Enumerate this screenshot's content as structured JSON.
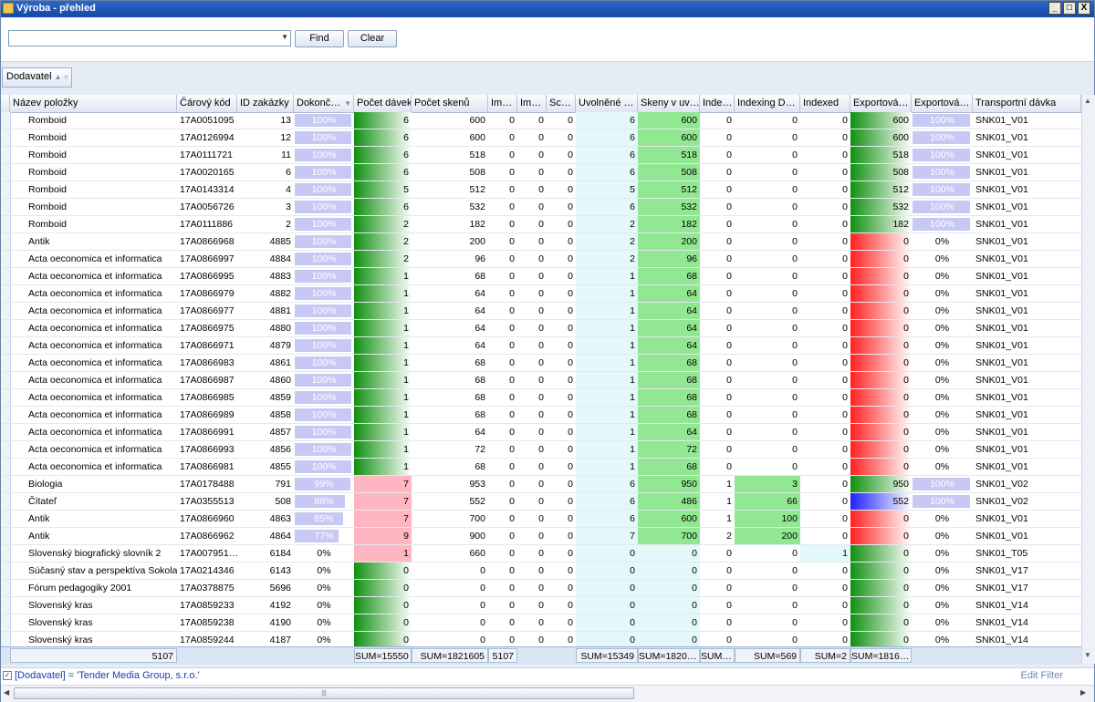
{
  "window": {
    "title": "Výroba - přehled",
    "btn_min": "_",
    "btn_max": "□",
    "btn_close": "X"
  },
  "toolbar": {
    "search_value": "",
    "find_label": "Find",
    "clear_label": "Clear"
  },
  "group_by": {
    "label": "Dodavatel"
  },
  "columns": [
    "Název položky",
    "Čárový kód",
    "ID zakázky",
    "Dokonč…",
    "Počet dávek",
    "Počet skenů",
    "Im…",
    "Im…",
    "Sc…",
    "Uvolněné …",
    "Skeny v uv…",
    "Inde…",
    "Indexing D…",
    "Indexed",
    "Exportová…",
    "Exportová…",
    "Transportní dávka"
  ],
  "rows": [
    {
      "n": "Romboid",
      "code": "17A0051095",
      "id": "13",
      "pct": 100,
      "pct_label": "100%",
      "davky": "6",
      "skeny": "600",
      "im1": "0",
      "im2": "0",
      "sc": "0",
      "uvol": "6",
      "skuv": "600",
      "ind": "0",
      "indd": "0",
      "indexed": "0",
      "exp": "600",
      "exp_state": "green",
      "exppct": 100,
      "exppct_label": "100%",
      "trans": "SNK01_V01",
      "pd_state": "green"
    },
    {
      "n": "Romboid",
      "code": "17A0126994",
      "id": "12",
      "pct": 100,
      "pct_label": "100%",
      "davky": "6",
      "skeny": "600",
      "im1": "0",
      "im2": "0",
      "sc": "0",
      "uvol": "6",
      "skuv": "600",
      "ind": "0",
      "indd": "0",
      "indexed": "0",
      "exp": "600",
      "exp_state": "green",
      "exppct": 100,
      "exppct_label": "100%",
      "trans": "SNK01_V01",
      "pd_state": "green"
    },
    {
      "n": "Romboid",
      "code": "17A0111721",
      "id": "11",
      "pct": 100,
      "pct_label": "100%",
      "davky": "6",
      "skeny": "518",
      "im1": "0",
      "im2": "0",
      "sc": "0",
      "uvol": "6",
      "skuv": "518",
      "ind": "0",
      "indd": "0",
      "indexed": "0",
      "exp": "518",
      "exp_state": "green",
      "exppct": 100,
      "exppct_label": "100%",
      "trans": "SNK01_V01",
      "pd_state": "green"
    },
    {
      "n": "Romboid",
      "code": "17A0020165",
      "id": "6",
      "pct": 100,
      "pct_label": "100%",
      "davky": "6",
      "skeny": "508",
      "im1": "0",
      "im2": "0",
      "sc": "0",
      "uvol": "6",
      "skuv": "508",
      "ind": "0",
      "indd": "0",
      "indexed": "0",
      "exp": "508",
      "exp_state": "green",
      "exppct": 100,
      "exppct_label": "100%",
      "trans": "SNK01_V01",
      "pd_state": "green"
    },
    {
      "n": "Romboid",
      "code": "17A0143314",
      "id": "4",
      "pct": 100,
      "pct_label": "100%",
      "davky": "5",
      "skeny": "512",
      "im1": "0",
      "im2": "0",
      "sc": "0",
      "uvol": "5",
      "skuv": "512",
      "ind": "0",
      "indd": "0",
      "indexed": "0",
      "exp": "512",
      "exp_state": "green",
      "exppct": 100,
      "exppct_label": "100%",
      "trans": "SNK01_V01",
      "pd_state": "green"
    },
    {
      "n": "Romboid",
      "code": "17A0056726",
      "id": "3",
      "pct": 100,
      "pct_label": "100%",
      "davky": "6",
      "skeny": "532",
      "im1": "0",
      "im2": "0",
      "sc": "0",
      "uvol": "6",
      "skuv": "532",
      "ind": "0",
      "indd": "0",
      "indexed": "0",
      "exp": "532",
      "exp_state": "green",
      "exppct": 100,
      "exppct_label": "100%",
      "trans": "SNK01_V01",
      "pd_state": "green"
    },
    {
      "n": "Romboid",
      "code": "17A0111886",
      "id": "2",
      "pct": 100,
      "pct_label": "100%",
      "davky": "2",
      "skeny": "182",
      "im1": "0",
      "im2": "0",
      "sc": "0",
      "uvol": "2",
      "skuv": "182",
      "ind": "0",
      "indd": "0",
      "indexed": "0",
      "exp": "182",
      "exp_state": "green",
      "exppct": 100,
      "exppct_label": "100%",
      "trans": "SNK01_V01",
      "pd_state": "green"
    },
    {
      "n": "Antik",
      "code": "17A0866968",
      "id": "4885",
      "pct": 100,
      "pct_label": "100%",
      "davky": "2",
      "skeny": "200",
      "im1": "0",
      "im2": "0",
      "sc": "0",
      "uvol": "2",
      "skuv": "200",
      "ind": "0",
      "indd": "0",
      "indexed": "0",
      "exp": "0",
      "exp_state": "red",
      "exppct": 0,
      "exppct_label": "0%",
      "trans": "SNK01_V01",
      "pd_state": "green"
    },
    {
      "n": "Acta oeconomica et informatica",
      "code": "17A0866997",
      "id": "4884",
      "pct": 100,
      "pct_label": "100%",
      "davky": "2",
      "skeny": "96",
      "im1": "0",
      "im2": "0",
      "sc": "0",
      "uvol": "2",
      "skuv": "96",
      "ind": "0",
      "indd": "0",
      "indexed": "0",
      "exp": "0",
      "exp_state": "red",
      "exppct": 0,
      "exppct_label": "0%",
      "trans": "SNK01_V01",
      "pd_state": "green"
    },
    {
      "n": "Acta oeconomica et informatica",
      "code": "17A0866995",
      "id": "4883",
      "pct": 100,
      "pct_label": "100%",
      "davky": "1",
      "skeny": "68",
      "im1": "0",
      "im2": "0",
      "sc": "0",
      "uvol": "1",
      "skuv": "68",
      "ind": "0",
      "indd": "0",
      "indexed": "0",
      "exp": "0",
      "exp_state": "red",
      "exppct": 0,
      "exppct_label": "0%",
      "trans": "SNK01_V01",
      "pd_state": "green"
    },
    {
      "n": "Acta oeconomica et informatica",
      "code": "17A0866979",
      "id": "4882",
      "pct": 100,
      "pct_label": "100%",
      "davky": "1",
      "skeny": "64",
      "im1": "0",
      "im2": "0",
      "sc": "0",
      "uvol": "1",
      "skuv": "64",
      "ind": "0",
      "indd": "0",
      "indexed": "0",
      "exp": "0",
      "exp_state": "red",
      "exppct": 0,
      "exppct_label": "0%",
      "trans": "SNK01_V01",
      "pd_state": "green"
    },
    {
      "n": "Acta oeconomica et informatica",
      "code": "17A0866977",
      "id": "4881",
      "pct": 100,
      "pct_label": "100%",
      "davky": "1",
      "skeny": "64",
      "im1": "0",
      "im2": "0",
      "sc": "0",
      "uvol": "1",
      "skuv": "64",
      "ind": "0",
      "indd": "0",
      "indexed": "0",
      "exp": "0",
      "exp_state": "red",
      "exppct": 0,
      "exppct_label": "0%",
      "trans": "SNK01_V01",
      "pd_state": "green"
    },
    {
      "n": "Acta oeconomica et informatica",
      "code": "17A0866975",
      "id": "4880",
      "pct": 100,
      "pct_label": "100%",
      "davky": "1",
      "skeny": "64",
      "im1": "0",
      "im2": "0",
      "sc": "0",
      "uvol": "1",
      "skuv": "64",
      "ind": "0",
      "indd": "0",
      "indexed": "0",
      "exp": "0",
      "exp_state": "red",
      "exppct": 0,
      "exppct_label": "0%",
      "trans": "SNK01_V01",
      "pd_state": "green"
    },
    {
      "n": "Acta oeconomica et informatica",
      "code": "17A0866971",
      "id": "4879",
      "pct": 100,
      "pct_label": "100%",
      "davky": "1",
      "skeny": "64",
      "im1": "0",
      "im2": "0",
      "sc": "0",
      "uvol": "1",
      "skuv": "64",
      "ind": "0",
      "indd": "0",
      "indexed": "0",
      "exp": "0",
      "exp_state": "red",
      "exppct": 0,
      "exppct_label": "0%",
      "trans": "SNK01_V01",
      "pd_state": "green"
    },
    {
      "n": "Acta oeconomica et informatica",
      "code": "17A0866983",
      "id": "4861",
      "pct": 100,
      "pct_label": "100%",
      "davky": "1",
      "skeny": "68",
      "im1": "0",
      "im2": "0",
      "sc": "0",
      "uvol": "1",
      "skuv": "68",
      "ind": "0",
      "indd": "0",
      "indexed": "0",
      "exp": "0",
      "exp_state": "red",
      "exppct": 0,
      "exppct_label": "0%",
      "trans": "SNK01_V01",
      "pd_state": "green"
    },
    {
      "n": "Acta oeconomica et informatica",
      "code": "17A0866987",
      "id": "4860",
      "pct": 100,
      "pct_label": "100%",
      "davky": "1",
      "skeny": "68",
      "im1": "0",
      "im2": "0",
      "sc": "0",
      "uvol": "1",
      "skuv": "68",
      "ind": "0",
      "indd": "0",
      "indexed": "0",
      "exp": "0",
      "exp_state": "red",
      "exppct": 0,
      "exppct_label": "0%",
      "trans": "SNK01_V01",
      "pd_state": "green"
    },
    {
      "n": "Acta oeconomica et informatica",
      "code": "17A0866985",
      "id": "4859",
      "pct": 100,
      "pct_label": "100%",
      "davky": "1",
      "skeny": "68",
      "im1": "0",
      "im2": "0",
      "sc": "0",
      "uvol": "1",
      "skuv": "68",
      "ind": "0",
      "indd": "0",
      "indexed": "0",
      "exp": "0",
      "exp_state": "red",
      "exppct": 0,
      "exppct_label": "0%",
      "trans": "SNK01_V01",
      "pd_state": "green"
    },
    {
      "n": "Acta oeconomica et informatica",
      "code": "17A0866989",
      "id": "4858",
      "pct": 100,
      "pct_label": "100%",
      "davky": "1",
      "skeny": "68",
      "im1": "0",
      "im2": "0",
      "sc": "0",
      "uvol": "1",
      "skuv": "68",
      "ind": "0",
      "indd": "0",
      "indexed": "0",
      "exp": "0",
      "exp_state": "red",
      "exppct": 0,
      "exppct_label": "0%",
      "trans": "SNK01_V01",
      "pd_state": "green"
    },
    {
      "n": "Acta oeconomica et informatica",
      "code": "17A0866991",
      "id": "4857",
      "pct": 100,
      "pct_label": "100%",
      "davky": "1",
      "skeny": "64",
      "im1": "0",
      "im2": "0",
      "sc": "0",
      "uvol": "1",
      "skuv": "64",
      "ind": "0",
      "indd": "0",
      "indexed": "0",
      "exp": "0",
      "exp_state": "red",
      "exppct": 0,
      "exppct_label": "0%",
      "trans": "SNK01_V01",
      "pd_state": "green"
    },
    {
      "n": "Acta oeconomica et informatica",
      "code": "17A0866993",
      "id": "4856",
      "pct": 100,
      "pct_label": "100%",
      "davky": "1",
      "skeny": "72",
      "im1": "0",
      "im2": "0",
      "sc": "0",
      "uvol": "1",
      "skuv": "72",
      "ind": "0",
      "indd": "0",
      "indexed": "0",
      "exp": "0",
      "exp_state": "red",
      "exppct": 0,
      "exppct_label": "0%",
      "trans": "SNK01_V01",
      "pd_state": "green"
    },
    {
      "n": "Acta oeconomica et informatica",
      "code": "17A0866981",
      "id": "4855",
      "pct": 100,
      "pct_label": "100%",
      "davky": "1",
      "skeny": "68",
      "im1": "0",
      "im2": "0",
      "sc": "0",
      "uvol": "1",
      "skuv": "68",
      "ind": "0",
      "indd": "0",
      "indexed": "0",
      "exp": "0",
      "exp_state": "red",
      "exppct": 0,
      "exppct_label": "0%",
      "trans": "SNK01_V01",
      "pd_state": "green"
    },
    {
      "n": "Biologia",
      "code": "17A0178488",
      "id": "791",
      "pct": 99,
      "pct_label": "99%",
      "davky": "7",
      "skeny": "953",
      "im1": "0",
      "im2": "0",
      "sc": "0",
      "uvol": "6",
      "skuv": "950",
      "ind": "1",
      "indd": "3",
      "indexed": "0",
      "exp": "950",
      "exp_state": "green",
      "exppct": 100,
      "exppct_label": "100%",
      "trans": "SNK01_V02",
      "pd_state": "pink"
    },
    {
      "n": "Čítateľ",
      "code": "17A0355513",
      "id": "508",
      "pct": 88,
      "pct_label": "88%",
      "davky": "7",
      "skeny": "552",
      "im1": "0",
      "im2": "0",
      "sc": "0",
      "uvol": "6",
      "skuv": "486",
      "ind": "1",
      "indd": "66",
      "indexed": "0",
      "exp": "552",
      "exp_state": "blue",
      "exppct": 100,
      "exppct_label": "100%",
      "trans": "SNK01_V02",
      "pd_state": "pink"
    },
    {
      "n": "Antik",
      "code": "17A0866960",
      "id": "4863",
      "pct": 85,
      "pct_label": "85%",
      "davky": "7",
      "skeny": "700",
      "im1": "0",
      "im2": "0",
      "sc": "0",
      "uvol": "6",
      "skuv": "600",
      "ind": "1",
      "indd": "100",
      "indexed": "0",
      "exp": "0",
      "exp_state": "red",
      "exppct": 0,
      "exppct_label": "0%",
      "trans": "SNK01_V01",
      "pd_state": "pink"
    },
    {
      "n": "Antik",
      "code": "17A0866962",
      "id": "4864",
      "pct": 77,
      "pct_label": "77%",
      "davky": "9",
      "skeny": "900",
      "im1": "0",
      "im2": "0",
      "sc": "0",
      "uvol": "7",
      "skuv": "700",
      "ind": "2",
      "indd": "200",
      "indexed": "0",
      "exp": "0",
      "exp_state": "red",
      "exppct": 0,
      "exppct_label": "0%",
      "trans": "SNK01_V01",
      "pd_state": "pink"
    },
    {
      "n": "Slovenský biografický slovník 2",
      "code": "17A007951…",
      "id": "6184",
      "pct": 0,
      "pct_label": "0%",
      "davky": "1",
      "skeny": "660",
      "im1": "0",
      "im2": "0",
      "sc": "0",
      "uvol": "0",
      "skuv": "0",
      "ind": "0",
      "indd": "0",
      "indexed": "1",
      "exp": "0",
      "exp_state": "green",
      "exppct": 0,
      "exppct_label": "0%",
      "trans": "SNK01_T05",
      "pd_state": "pink"
    },
    {
      "n": "Súčasný stav a perspektíva Sokola",
      "code": "17A0214346",
      "id": "6143",
      "pct": 0,
      "pct_label": "0%",
      "davky": "0",
      "skeny": "0",
      "im1": "0",
      "im2": "0",
      "sc": "0",
      "uvol": "0",
      "skuv": "0",
      "ind": "0",
      "indd": "0",
      "indexed": "0",
      "exp": "0",
      "exp_state": "green",
      "exppct": 0,
      "exppct_label": "0%",
      "trans": "SNK01_V17",
      "pd_state": "green"
    },
    {
      "n": "Fórum pedagogiky 2001",
      "code": "17A0378875",
      "id": "5696",
      "pct": 0,
      "pct_label": "0%",
      "davky": "0",
      "skeny": "0",
      "im1": "0",
      "im2": "0",
      "sc": "0",
      "uvol": "0",
      "skuv": "0",
      "ind": "0",
      "indd": "0",
      "indexed": "0",
      "exp": "0",
      "exp_state": "green",
      "exppct": 0,
      "exppct_label": "0%",
      "trans": "SNK01_V17",
      "pd_state": "green"
    },
    {
      "n": "Slovenský kras",
      "code": "17A0859233",
      "id": "4192",
      "pct": 0,
      "pct_label": "0%",
      "davky": "0",
      "skeny": "0",
      "im1": "0",
      "im2": "0",
      "sc": "0",
      "uvol": "0",
      "skuv": "0",
      "ind": "0",
      "indd": "0",
      "indexed": "0",
      "exp": "0",
      "exp_state": "green",
      "exppct": 0,
      "exppct_label": "0%",
      "trans": "SNK01_V14",
      "pd_state": "green"
    },
    {
      "n": "Slovenský kras",
      "code": "17A0859238",
      "id": "4190",
      "pct": 0,
      "pct_label": "0%",
      "davky": "0",
      "skeny": "0",
      "im1": "0",
      "im2": "0",
      "sc": "0",
      "uvol": "0",
      "skuv": "0",
      "ind": "0",
      "indd": "0",
      "indexed": "0",
      "exp": "0",
      "exp_state": "green",
      "exppct": 0,
      "exppct_label": "0%",
      "trans": "SNK01_V14",
      "pd_state": "green"
    },
    {
      "n": "Slovenský kras",
      "code": "17A0859244",
      "id": "4187",
      "pct": 0,
      "pct_label": "0%",
      "davky": "0",
      "skeny": "0",
      "im1": "0",
      "im2": "0",
      "sc": "0",
      "uvol": "0",
      "skuv": "0",
      "ind": "0",
      "indd": "0",
      "indexed": "0",
      "exp": "0",
      "exp_state": "green",
      "exppct": 0,
      "exppct_label": "0%",
      "trans": "SNK01_V14",
      "pd_state": "green"
    }
  ],
  "footer": {
    "id_sum": "5107",
    "davky": "SUM=15550",
    "skeny": "SUM=1821605",
    "im": "5107",
    "uvol": "SUM=15349",
    "skuv": "SUM=1820…",
    "ind": "SUM…",
    "indd": "SUM=569",
    "indexed": "SUM=2",
    "exp": "SUM=1816…"
  },
  "filter": {
    "checked": "✓",
    "text": "[Dodavatel] = 'Tender Media Group, s.r.o.'",
    "edit": "Edit Filter"
  },
  "colors": {
    "green": "#109010",
    "red": "#ff2020",
    "blue": "#2020ff",
    "pink": "#ffb6c1",
    "light_green": "#92e892",
    "light_cyan": "#e4f8fa",
    "progress": "#c8c8f4"
  }
}
